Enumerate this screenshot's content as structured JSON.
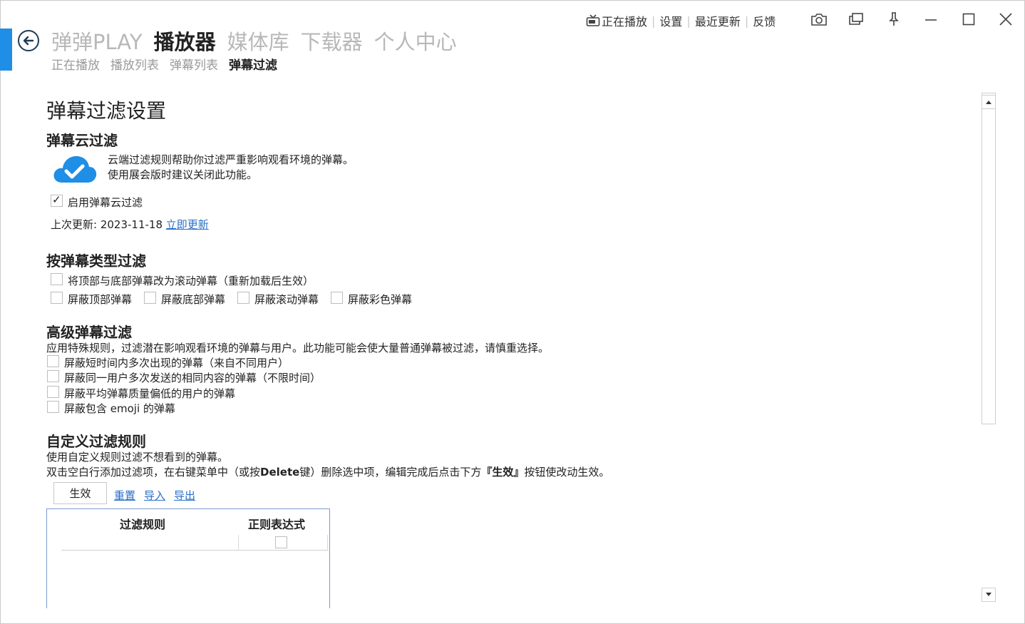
{
  "topbar": {
    "now_playing": "正在播放",
    "settings": "设置",
    "recent_updates": "最近更新",
    "feedback": "反馈"
  },
  "nav": {
    "main": [
      "弹弹PLAY",
      "播放器",
      "媒体库",
      "下载器",
      "个人中心"
    ],
    "sub": [
      "正在播放",
      "播放列表",
      "弹幕列表",
      "弹幕过滤"
    ]
  },
  "page": {
    "title": "弹幕过滤设置"
  },
  "cloud": {
    "heading": "弹幕云过滤",
    "desc1": "云端过滤规则帮助你过滤严重影响观看环境的弹幕。",
    "desc2": "使用展会版时建议关闭此功能。",
    "enable_label": "启用弹幕云过滤",
    "enable_checked": true,
    "last_update_label": "上次更新: 2023-11-18",
    "update_now": "立即更新"
  },
  "type_filter": {
    "heading": "按弹幕类型过滤",
    "convert_label": "将顶部与底部弹幕改为滚动弹幕（重新加载后生效）",
    "block_top": "屏蔽顶部弹幕",
    "block_bottom": "屏蔽底部弹幕",
    "block_scroll": "屏蔽滚动弹幕",
    "block_color": "屏蔽彩色弹幕"
  },
  "advanced": {
    "heading": "高级弹幕过滤",
    "desc": "应用特殊规则，过滤潜在影响观看环境的弹幕与用户。此功能可能会使大量普通弹幕被过滤，请慎重选择。",
    "opt1": "屏蔽短时间内多次出现的弹幕（来自不同用户）",
    "opt2": "屏蔽同一用户多次发送的相同内容的弹幕（不限时间）",
    "opt3": "屏蔽平均弹幕质量偏低的用户的弹幕",
    "opt4": "屏蔽包含 emoji 的弹幕"
  },
  "custom": {
    "heading": "自定义过滤规则",
    "desc1": "使用自定义规则过滤不想看到的弹幕。",
    "desc2_a": "双击空白行添加过滤项，在右键菜单中（或按",
    "desc2_key": "Delete",
    "desc2_b": "键）删除选中项，编辑完成后点击下方",
    "desc2_btn": "『生效』",
    "desc2_c": "按钮使改动生效。",
    "apply": "生效",
    "reset": "重置",
    "import": "导入",
    "export": "导出",
    "col_rule": "过滤规则",
    "col_regex": "正则表达式"
  },
  "colors": {
    "accent": "#1e8ee6",
    "link": "#2a6ec7",
    "cloud": "#1e8ee6"
  }
}
